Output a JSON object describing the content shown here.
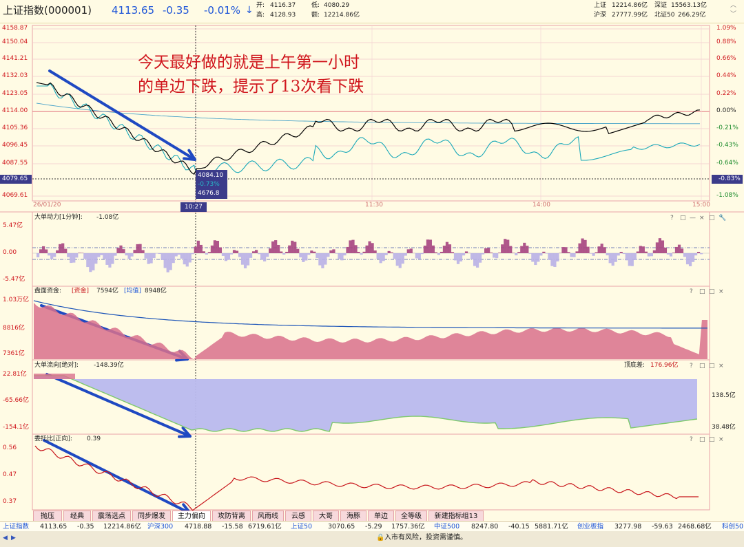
{
  "header": {
    "index_name": "上证指数(000001)",
    "price": "4113.65",
    "change": "-0.35",
    "change_pct": "-0.01%",
    "arrow": "↓",
    "open_label": "开:",
    "open": "4116.37",
    "low_label": "低:",
    "low": "4080.29",
    "high_label": "高:",
    "high": "4128.93",
    "amount_label": "额:",
    "amount": "12214.86亿",
    "sh_label": "上证",
    "sh_amount": "12214.86亿",
    "sz_label": "深证",
    "sz_amount": "15563.13亿",
    "hs_label": "沪深",
    "hs_amount": "27777.99亿",
    "nb_label": "北证50",
    "nb_amount": "266.29亿"
  },
  "main_chart": {
    "y_left": [
      "4158.87",
      "4150.04",
      "4141.21",
      "4132.03",
      "4123.05",
      "4114.00",
      "4105.36",
      "4096.45",
      "4087.55",
      "4069.61"
    ],
    "y_right": [
      "1.09%",
      "0.88%",
      "0.66%",
      "0.44%",
      "0.22%",
      "0.00%",
      "-0.21%",
      "-0.43%",
      "-0.64%",
      "-1.08%"
    ],
    "cursor_price": "4079.65",
    "cursor_pct": "-0.83%",
    "cursor_time": "10:27",
    "tooltip": [
      "4084.10",
      "-0.73%",
      "4676.8"
    ],
    "x_labels": [
      "26/01/20",
      "11:30",
      "14:00",
      "15:00"
    ],
    "annotation_line1": "今天最好做的就是上午第一小时",
    "annotation_line2": "的单边下跌，提示了13次看下跌",
    "colors": {
      "price": "#000000",
      "avg": "#1aa3b8",
      "ref": "#e5878c",
      "annotation": "#d0171e",
      "arrow": "#1f49c2"
    }
  },
  "panel1": {
    "title": "大单动力[1分钟]:",
    "value": "-1.08亿",
    "y": [
      "5.47亿",
      "0.00",
      "-5.47亿"
    ]
  },
  "panel2": {
    "title": "盘面资金:",
    "tag1": "[资金]",
    "tag1_value": "7594亿",
    "tag2": "[均值]",
    "tag2_value": "8948亿",
    "y": [
      "1.03万亿",
      "8816亿",
      "7361亿"
    ]
  },
  "panel3": {
    "title": "大单流向[绝对]:",
    "value": "-148.39亿",
    "diff_label": "顶底差:",
    "diff_value": "176.96亿",
    "y": [
      "22.81亿",
      "-65.66亿",
      "-154.1亿"
    ],
    "y_right": [
      "138.5亿",
      "38.48亿"
    ]
  },
  "panel4": {
    "title": "委托比[正向]:",
    "value": "0.39",
    "y": [
      "0.56",
      "0.47",
      "0.37"
    ]
  },
  "panel_icons": [
    "?",
    "□",
    "—",
    "×",
    "□",
    "🔧"
  ],
  "tabs": [
    "抛压",
    "经典",
    "震荡选点",
    "同步爆发",
    "主力偏向",
    "攻防背离",
    "风雨线",
    "云感",
    "大哥",
    "海豚",
    "单边",
    "全等级",
    "新建指标组13"
  ],
  "bottom_row": [
    {
      "name": "上证指数",
      "price": "4113.65",
      "chg": "-0.35",
      "amt": "12214.86亿"
    },
    {
      "name": "沪深300",
      "price": "4718.88",
      "chg": "-15.58",
      "amt": "6719.61亿"
    },
    {
      "name": "上证50",
      "price": "3070.65",
      "chg": "-5.29",
      "amt": "1757.36亿"
    },
    {
      "name": "中证500",
      "price": "8247.80",
      "chg": "-40.15",
      "amt": "5881.71亿"
    },
    {
      "name": "创业板指",
      "price": "3277.98",
      "chg": "-59.63",
      "amt": "2468.68亿"
    },
    {
      "name": "科创50",
      "price": "",
      "chg": "",
      "amt": ""
    }
  ],
  "status": {
    "risk_text": "入市有风险，投资需谨慎。"
  }
}
